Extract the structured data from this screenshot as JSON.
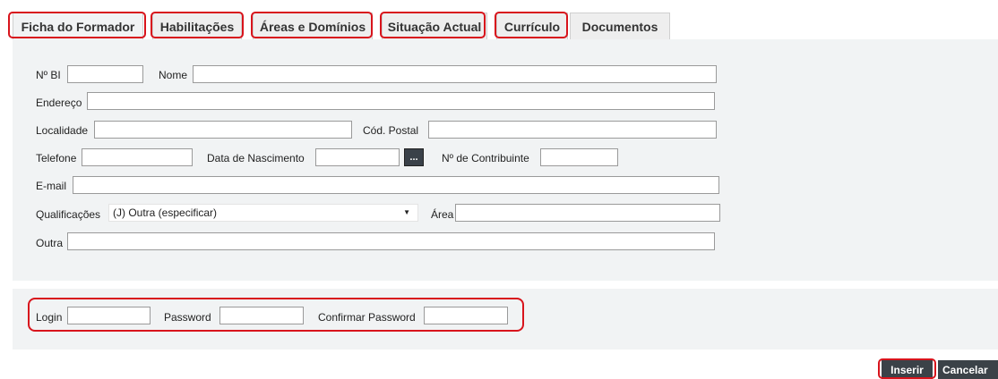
{
  "tabs": [
    {
      "label": "Ficha do Formador",
      "highlighted": true,
      "active": true
    },
    {
      "label": "Habilitações",
      "highlighted": true
    },
    {
      "label": "Áreas e Domínios",
      "highlighted": true
    },
    {
      "label": "Situação Actual",
      "highlighted": true
    },
    {
      "label": "Currículo",
      "highlighted": true
    },
    {
      "label": "Documentos",
      "highlighted": false
    }
  ],
  "form": {
    "bi_label": "Nº BI",
    "nome_label": "Nome",
    "endereco_label": "Endereço",
    "localidade_label": "Localidade",
    "cod_postal_label": "Cód. Postal",
    "telefone_label": "Telefone",
    "data_nascimento_label": "Data de Nascimento",
    "date_button_label": "...",
    "contribuinte_label": "Nº de Contribuinte",
    "email_label": "E-mail",
    "qualificacoes_label": "Qualificações",
    "qualificacoes_value": "(J) Outra (especificar)",
    "area_label": "Área",
    "outra_label": "Outra"
  },
  "login": {
    "login_label": "Login",
    "password_label": "Password",
    "confirm_label": "Confirmar Password"
  },
  "actions": {
    "insert_label": "Inserir",
    "cancel_label": "Cancelar"
  },
  "colors": {
    "highlight": "#d8141c",
    "panel": "#f1f3f4",
    "button": "#3b4248"
  }
}
